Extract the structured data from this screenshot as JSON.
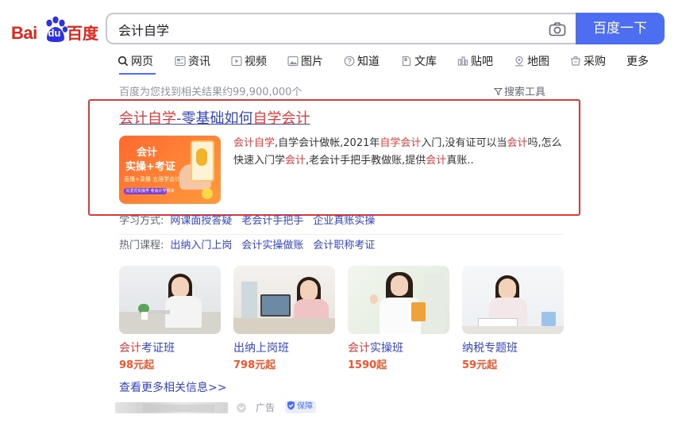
{
  "logo": {
    "bai": "Bai",
    "du": "du",
    "cn": "百度"
  },
  "search": {
    "value": "会计自学",
    "button": "百度一下"
  },
  "tabs": [
    {
      "label": "网页",
      "icon": "search-icon"
    },
    {
      "label": "资讯",
      "icon": "news-icon"
    },
    {
      "label": "视频",
      "icon": "video-icon"
    },
    {
      "label": "图片",
      "icon": "image-icon"
    },
    {
      "label": "知道",
      "icon": "question-icon"
    },
    {
      "label": "文库",
      "icon": "doc-icon"
    },
    {
      "label": "贴吧",
      "icon": "tieba-icon"
    },
    {
      "label": "地图",
      "icon": "map-icon"
    },
    {
      "label": "采购",
      "icon": "cart-icon"
    },
    {
      "label": "更多",
      "icon": ""
    }
  ],
  "results_info": {
    "count": "百度为您找到相关结果约99,900,000个",
    "tools": "搜索工具"
  },
  "result": {
    "title": [
      "会计自学",
      "-零基础如何",
      "自学会计"
    ],
    "thumb": {
      "line1": "会计",
      "line2": "实操+考证",
      "line3": "直播+录播 五境学会计",
      "line4": "沉浸式实操学 考会计学校来"
    },
    "desc": [
      [
        "会计自学",
        true
      ],
      [
        ",自学会计做帐,2021年",
        false
      ],
      [
        "自学会计",
        true
      ],
      [
        "入门,没有证可以当",
        false
      ],
      [
        "会计",
        true
      ],
      [
        "吗,怎么快速入门学",
        false
      ],
      [
        "会计",
        true
      ],
      [
        ",老会计手把手教做账,提供",
        false
      ],
      [
        "会计",
        true
      ],
      [
        "真账..",
        false
      ]
    ]
  },
  "study_row": {
    "label": "学习方式:",
    "links": [
      "网课面授答疑",
      "老会计手把手",
      "企业真账实操"
    ]
  },
  "hot_row": {
    "label": "热门课程:",
    "links": [
      "出纳入门上岗",
      "会计实操做账",
      "会计职称考证"
    ]
  },
  "courses": [
    {
      "title_em": "会计",
      "title": "考证班",
      "price": "98元起"
    },
    {
      "title_em": "",
      "title": "出纳上岗班",
      "price": "798元起"
    },
    {
      "title_em": "会计",
      "title": "实操班",
      "price": "1590起"
    },
    {
      "title_em": "",
      "title": "纳税专题班",
      "price": "59元起"
    }
  ],
  "more_link": "查看更多相关信息>>",
  "footer": {
    "ad": "广告",
    "guarantee": "保障"
  },
  "colors": {
    "brand_blue": "#4e6ef2",
    "brand_red": "#e1251b",
    "link": "#3445c9",
    "highlight": "#e33a3a",
    "price": "#f5542b",
    "annotation_box": "#e63935"
  }
}
